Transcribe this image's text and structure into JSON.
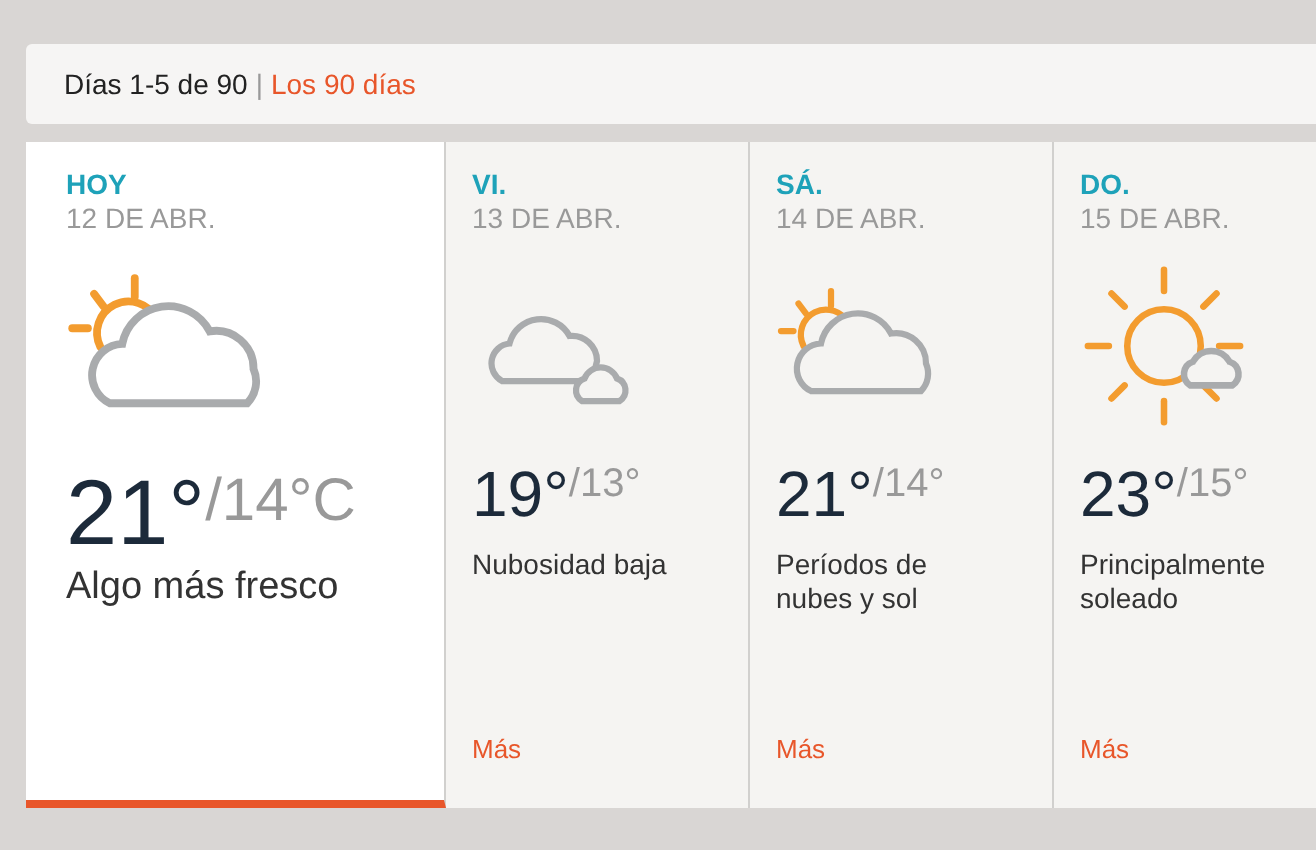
{
  "range_bar": {
    "current": "Días 1-5 de 90",
    "separator": "|",
    "link": "Los 90 días"
  },
  "days": [
    {
      "day": "HOY",
      "date": "12 DE ABR.",
      "kind": "sun-cloud",
      "high": "21°",
      "low": "/14°C",
      "condition": "Algo más fresco",
      "selected": true
    },
    {
      "day": "VI.",
      "date": "13 DE ABR.",
      "kind": "clouds",
      "high": "19°",
      "low": "/13°",
      "condition": "Nubosidad baja",
      "more": "Más",
      "selected": false
    },
    {
      "day": "SÁ.",
      "date": "14 DE ABR.",
      "kind": "sun-cloud",
      "high": "21°",
      "low": "/14°",
      "condition": "Períodos de nubes y sol",
      "more": "Más",
      "selected": false
    },
    {
      "day": "DO.",
      "date": "15 DE ABR.",
      "kind": "sun-small-cloud",
      "high": "23°",
      "low": "/15°",
      "condition": "Principalmente soleado",
      "more": "Más",
      "selected": false
    }
  ]
}
